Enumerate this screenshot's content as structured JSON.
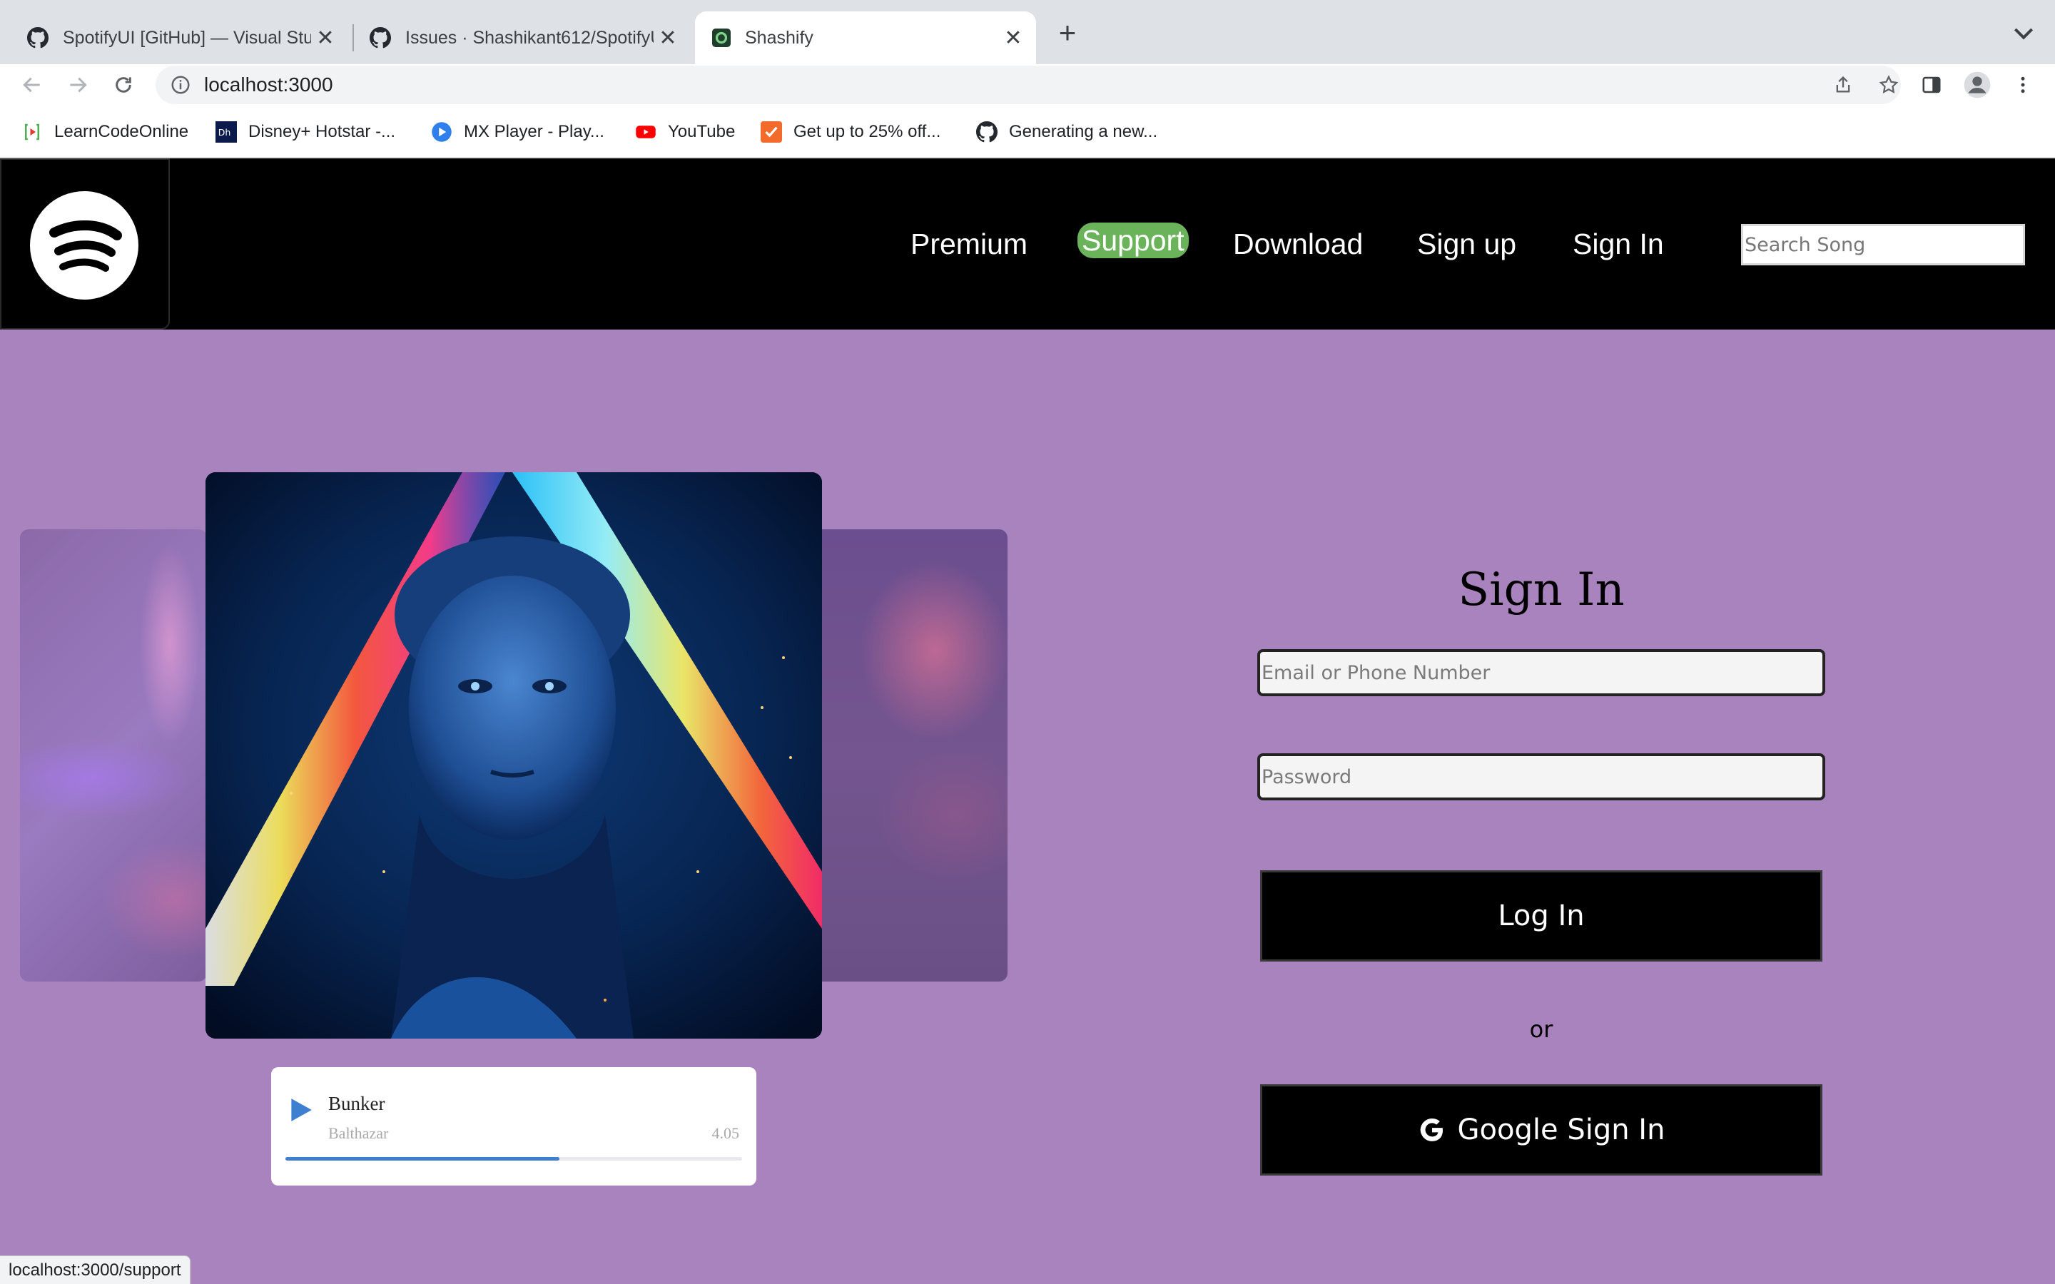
{
  "browser": {
    "tabs": [
      {
        "title": "SpotifyUI [GitHub] — Visual Studio Code",
        "icon": "github-icon",
        "close": "✕"
      },
      {
        "title": "Issues · Shashikant612/SpotifyUI",
        "icon": "github-icon",
        "close": "✕"
      },
      {
        "title": "Shashify",
        "icon": "spotify-favicon",
        "close": "✕"
      }
    ],
    "new_tab": "+",
    "url": "localhost:3000",
    "bookmarks": [
      {
        "label": "LearnCodeOnline",
        "icon": "learncodeonline-icon"
      },
      {
        "label": "Disney+ Hotstar -...",
        "icon": "hotstar-icon"
      },
      {
        "label": "MX Player - Play...",
        "icon": "mxplayer-icon"
      },
      {
        "label": "YouTube",
        "icon": "youtube-icon"
      },
      {
        "label": "Get up to 25% off...",
        "icon": "offer-icon"
      },
      {
        "label": "Generating a new...",
        "icon": "github-icon"
      }
    ],
    "status_url": "localhost:3000/support"
  },
  "nav": {
    "links": [
      "Premium",
      "Support",
      "Download",
      "Sign up",
      "Sign In"
    ],
    "search_placeholder": "Search Song",
    "highlight_color": "#6ab35a"
  },
  "player": {
    "title": "Bunker",
    "artist": "Balthazar",
    "time": "4.05",
    "progress": 0.6
  },
  "signin": {
    "title": "Sign In",
    "email_placeholder": "Email or Phone Number",
    "password_placeholder": "Password",
    "login_label": "Log In",
    "or_label": "or",
    "google_label": "Google Sign In"
  },
  "colors": {
    "page_bg": "#a983bd",
    "nav_bg": "#000000",
    "accent": "#3f7fcf"
  }
}
